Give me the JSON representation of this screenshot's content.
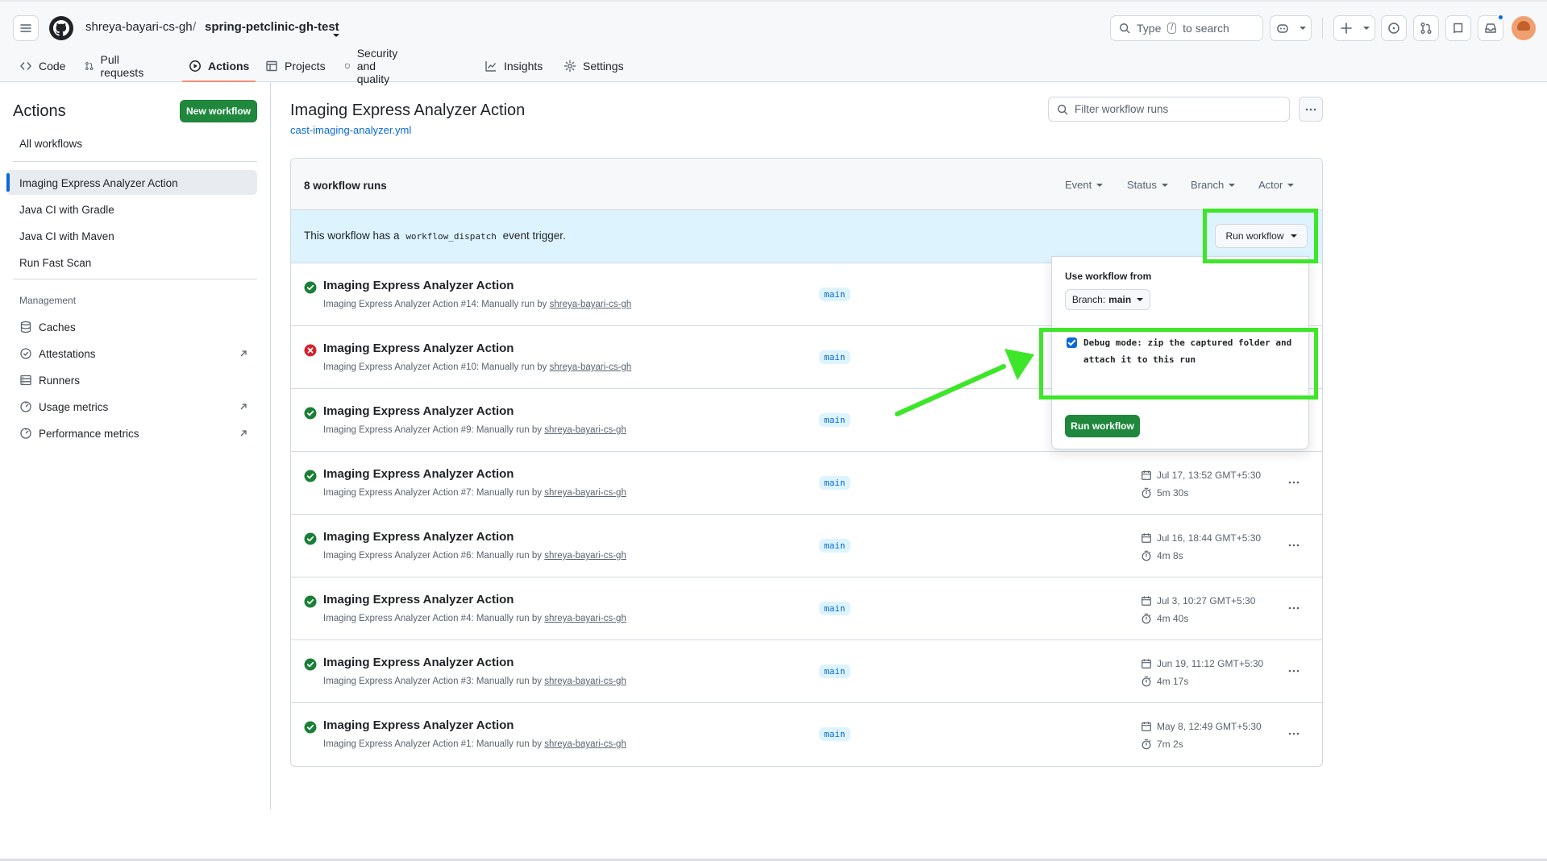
{
  "header": {
    "owner": "shreya-bayari-cs-gh",
    "separator": "/",
    "repo": "spring-petclinic-gh-test",
    "search_prefix": "Type",
    "search_key": "/",
    "search_suffix": "to search"
  },
  "tabs": [
    {
      "label": "Code",
      "icon": "code-icon"
    },
    {
      "label": "Pull requests",
      "icon": "pull-request-icon"
    },
    {
      "label": "Actions",
      "icon": "play-icon",
      "active": true
    },
    {
      "label": "Projects",
      "icon": "table-icon"
    },
    {
      "label": "Security and quality",
      "icon": "shield-icon"
    },
    {
      "label": "Insights",
      "icon": "graph-icon"
    },
    {
      "label": "Settings",
      "icon": "gear-icon"
    }
  ],
  "sidebar": {
    "title": "Actions",
    "new_workflow": "New workflow",
    "all_workflows": "All workflows",
    "workflows": [
      "Imaging Express Analyzer Action",
      "Java CI with Gradle",
      "Java CI with Maven",
      "Run Fast Scan"
    ],
    "management_label": "Management",
    "management": [
      {
        "label": "Caches",
        "icon": "cache-icon",
        "external": false
      },
      {
        "label": "Attestations",
        "icon": "attestation-icon",
        "external": true
      },
      {
        "label": "Runners",
        "icon": "server-icon",
        "external": false
      },
      {
        "label": "Usage metrics",
        "icon": "meter-icon",
        "external": true
      },
      {
        "label": "Performance metrics",
        "icon": "meter-icon",
        "external": true
      }
    ]
  },
  "main": {
    "title": "Imaging Express Analyzer Action",
    "file": "cast-imaging-analyzer.yml",
    "filter_placeholder": "Filter workflow runs",
    "run_count": "8 workflow runs",
    "filters": [
      "Event",
      "Status",
      "Branch",
      "Actor"
    ],
    "banner_prefix": "This workflow has a",
    "banner_code": "workflow_dispatch",
    "banner_suffix": "event trigger.",
    "run_workflow_button": "Run workflow"
  },
  "runs": [
    {
      "title": "Imaging Express Analyzer Action",
      "sub": "Imaging Express Analyzer Action #14: Manually run by",
      "user": "shreya-bayari-cs-gh",
      "branch": "main",
      "status": "success",
      "date": "",
      "duration": ""
    },
    {
      "title": "Imaging Express Analyzer Action",
      "sub": "Imaging Express Analyzer Action #10: Manually run by",
      "user": "shreya-bayari-cs-gh",
      "branch": "main",
      "status": "failure",
      "date": "",
      "duration": ""
    },
    {
      "title": "Imaging Express Analyzer Action",
      "sub": "Imaging Express Analyzer Action #9: Manually run by",
      "user": "shreya-bayari-cs-gh",
      "branch": "main",
      "status": "success",
      "date": "",
      "duration": ""
    },
    {
      "title": "Imaging Express Analyzer Action",
      "sub": "Imaging Express Analyzer Action #7: Manually run by",
      "user": "shreya-bayari-cs-gh",
      "branch": "main",
      "status": "success",
      "date": "Jul 17, 13:52 GMT+5:30",
      "duration": "5m 30s"
    },
    {
      "title": "Imaging Express Analyzer Action",
      "sub": "Imaging Express Analyzer Action #6: Manually run by",
      "user": "shreya-bayari-cs-gh",
      "branch": "main",
      "status": "success",
      "date": "Jul 16, 18:44 GMT+5:30",
      "duration": "4m 8s"
    },
    {
      "title": "Imaging Express Analyzer Action",
      "sub": "Imaging Express Analyzer Action #4: Manually run by",
      "user": "shreya-bayari-cs-gh",
      "branch": "main",
      "status": "success",
      "date": "Jul 3, 10:27 GMT+5:30",
      "duration": "4m 40s"
    },
    {
      "title": "Imaging Express Analyzer Action",
      "sub": "Imaging Express Analyzer Action #3: Manually run by",
      "user": "shreya-bayari-cs-gh",
      "branch": "main",
      "status": "success",
      "date": "Jun 19, 11:12 GMT+5:30",
      "duration": "4m 17s"
    },
    {
      "title": "Imaging Express Analyzer Action",
      "sub": "Imaging Express Analyzer Action #1: Manually run by",
      "user": "shreya-bayari-cs-gh",
      "branch": "main",
      "status": "success",
      "date": "May 8, 12:49 GMT+5:30",
      "duration": "7m 2s"
    }
  ],
  "dropdown": {
    "use_from_label": "Use workflow from",
    "branch_label": "Branch:",
    "branch_value": "main",
    "debug_line1": "Debug mode: zip the captured folder and",
    "debug_line2": "attach it to this run",
    "debug_checked": true,
    "run_button": "Run workflow"
  },
  "colors": {
    "accent": "#0969da",
    "success": "#1a7f37",
    "failure": "#d1242f",
    "primary_button": "#1f883d",
    "highlight": "#3ee62a",
    "banner_bg": "#ddf4ff"
  }
}
